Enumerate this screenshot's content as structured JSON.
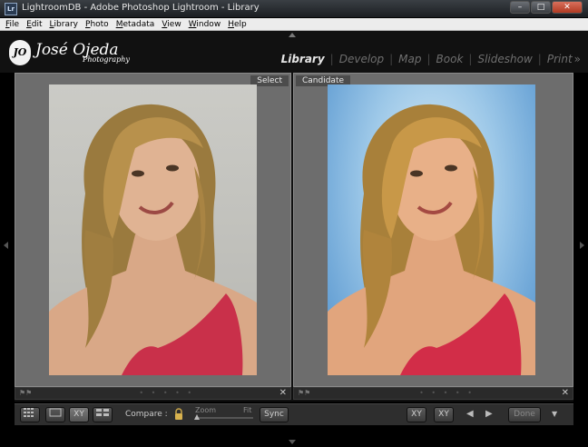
{
  "window": {
    "icon_text": "Lr",
    "title": "LightroomDB - Adobe Photoshop Lightroom - Library",
    "buttons": [
      "–",
      "□",
      "✕"
    ]
  },
  "menu": [
    "File",
    "Edit",
    "Library",
    "Photo",
    "Metadata",
    "View",
    "Window",
    "Help"
  ],
  "identity_plate": {
    "badge": "JO",
    "name": "José Ojeda",
    "sub": "Photography"
  },
  "modules": {
    "items": [
      "Library",
      "Develop",
      "Map",
      "Book",
      "Slideshow",
      "Print"
    ],
    "active": "Library",
    "more": "»"
  },
  "compare": {
    "select_label": "Select",
    "candidate_label": "Candidate"
  },
  "filmstrip": {
    "dots": "• • • • •",
    "close": "✕"
  },
  "toolbar": {
    "compare_label": "Compare :",
    "zoom_label": "Zoom",
    "fit_label": "Fit",
    "sync_label": "Sync",
    "swap_label": "XY",
    "make_select_label": "XY",
    "done_label": "Done",
    "view_modes": [
      "grid",
      "loupe",
      "XY",
      "survey"
    ],
    "prev": "◀",
    "next": "▶",
    "menu": "▼"
  },
  "colors": {
    "active_module": "#e6e6e6",
    "inactive_module": "#6f6f6f",
    "candidate_bg": "#4f90cc"
  }
}
